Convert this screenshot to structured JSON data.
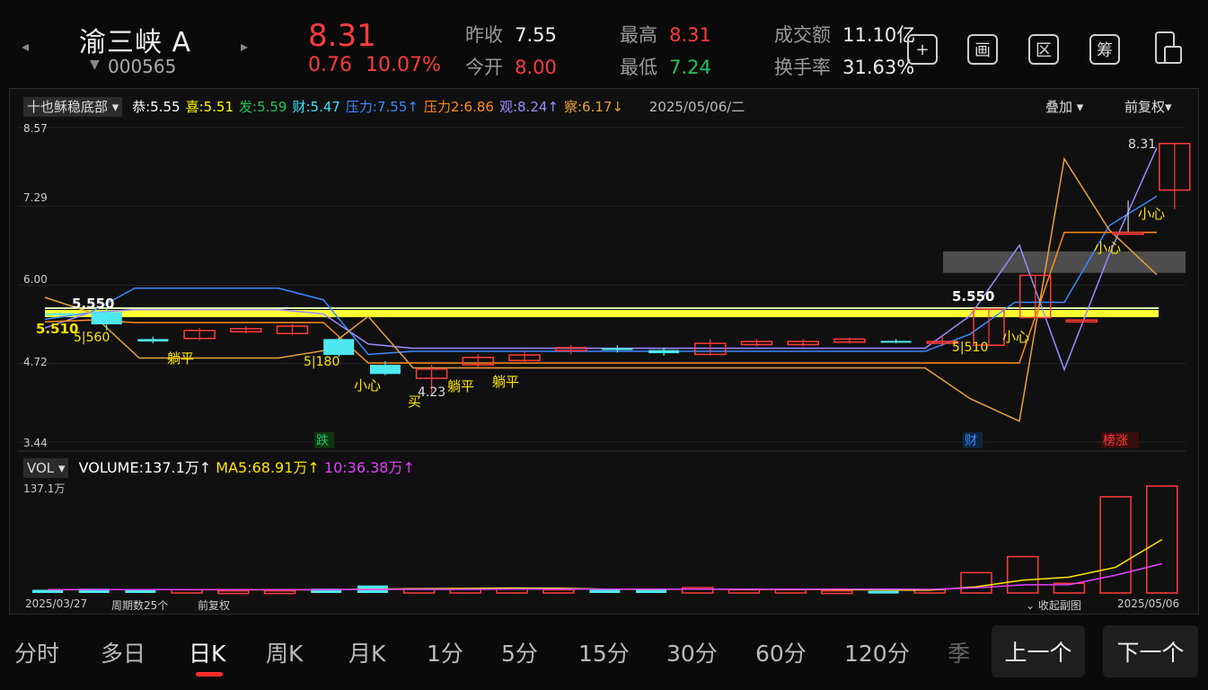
{
  "header": {
    "name": "渝三峡 A",
    "code": "000565",
    "price": "8.31",
    "change": "0.76",
    "change_pct": "10.07%",
    "prev_close_label": "昨收",
    "prev_close": "7.55",
    "open_label": "今开",
    "open": "8.00",
    "high_label": "最高",
    "high": "8.31",
    "low_label": "最低",
    "low": "7.24",
    "turnover_label": "成交额",
    "turnover": "11.10亿",
    "rate_label": "换手率",
    "rate": "31.63%"
  },
  "toolbar_icons": [
    "add-icon",
    "draw-icon",
    "range-icon",
    "chip-icon",
    "fullscreen-icon"
  ],
  "toolbar_text": {
    "draw": "画",
    "range": "区",
    "chip": "筹"
  },
  "indicator": {
    "name": "十也稣稳底部",
    "items": [
      {
        "label": "恭:",
        "value": "5.55",
        "color": "#ffffff"
      },
      {
        "label": "喜:",
        "value": "5.51",
        "color": "#ffff00"
      },
      {
        "label": "发:",
        "value": "5.59",
        "color": "#21c55d"
      },
      {
        "label": "财:",
        "value": "5.47",
        "color": "#40e0ff"
      },
      {
        "label": "压力:",
        "value": "7.55↑",
        "color": "#3b8bff"
      },
      {
        "label": "压力2:",
        "value": "6.86",
        "color": "#ff8c1a"
      },
      {
        "label": "观:",
        "value": "8.24↑",
        "color": "#9b8cff"
      },
      {
        "label": "察:",
        "value": "6.17↓",
        "color": "#e6a23c"
      }
    ],
    "date": "2025/05/06/二",
    "overlay": "叠加",
    "adjust": "前复权"
  },
  "price_axis": [
    "8.57",
    "7.29",
    "6.00",
    "4.72",
    "3.44"
  ],
  "chart_labels": {
    "hi_left": "5.550",
    "lo_left": "5.510",
    "hi_right": "5.550",
    "max_price": "8.31",
    "min_price": "4.23",
    "fall": "跌",
    "cai": "财",
    "bang": "榜",
    "zhang": "涨",
    "lie1": "躺平",
    "lie2": "躺平",
    "lie3": "躺平",
    "careful1": "小心",
    "careful2": "小心",
    "careful3": "小心",
    "careful4": "小心",
    "buy": "买",
    "s1": "5|560",
    "s2": "5|180",
    "s3": "5|510"
  },
  "volume": {
    "name": "VOL",
    "vol_label": "VOLUME:",
    "vol": "137.1万↑",
    "ma5_label": "MA5:",
    "ma5": "68.91万↑",
    "ma10_label": "10:",
    "ma10": "36.38万↑",
    "axis_top": "137.1万"
  },
  "footer": {
    "start_date": "2025/03/27",
    "period": "周期数25个",
    "adjust": "前复权",
    "collapse": "收起副图",
    "end_date": "2025/05/06"
  },
  "tabs": [
    "分时",
    "多日",
    "日K",
    "周K",
    "月K",
    "1分",
    "5分",
    "15分",
    "30分",
    "60分",
    "120分",
    "季"
  ],
  "active_tab": "日K",
  "prev_button": "上一个",
  "next_button": "下一个",
  "chart_data": {
    "type": "candlestick",
    "categories": [
      "c1",
      "c2",
      "c3",
      "c4",
      "c5",
      "c6",
      "c7",
      "c8",
      "c9",
      "c10",
      "c11",
      "c12",
      "c13",
      "c14",
      "c15",
      "c16",
      "c17",
      "c18",
      "c19",
      "c20",
      "c21",
      "c22",
      "c23",
      "c24",
      "c25"
    ],
    "ylim": [
      3.44,
      8.57
    ],
    "candles": [
      {
        "o": 5.54,
        "c": 5.52,
        "h": 5.56,
        "l": 5.5
      },
      {
        "o": 5.56,
        "c": 5.36,
        "h": 5.63,
        "l": 5.26
      },
      {
        "o": 5.12,
        "c": 5.08,
        "h": 5.16,
        "l": 5.05
      },
      {
        "o": 5.13,
        "c": 5.26,
        "h": 5.3,
        "l": 5.1
      },
      {
        "o": 5.24,
        "c": 5.29,
        "h": 5.33,
        "l": 5.21
      },
      {
        "o": 5.21,
        "c": 5.33,
        "h": 5.36,
        "l": 5.18
      },
      {
        "o": 5.12,
        "c": 4.86,
        "h": 5.14,
        "l": 4.83
      },
      {
        "o": 4.7,
        "c": 4.55,
        "h": 4.76,
        "l": 4.53
      },
      {
        "o": 4.48,
        "c": 4.63,
        "h": 4.7,
        "l": 4.23
      },
      {
        "o": 4.7,
        "c": 4.82,
        "h": 4.87,
        "l": 4.66
      },
      {
        "o": 4.77,
        "c": 4.86,
        "h": 4.93,
        "l": 4.73
      },
      {
        "o": 4.93,
        "c": 4.98,
        "h": 5.02,
        "l": 4.87
      },
      {
        "o": 4.97,
        "c": 4.94,
        "h": 5.02,
        "l": 4.9
      },
      {
        "o": 4.94,
        "c": 4.89,
        "h": 4.98,
        "l": 4.85
      },
      {
        "o": 4.87,
        "c": 5.05,
        "h": 5.12,
        "l": 4.85
      },
      {
        "o": 5.03,
        "c": 5.08,
        "h": 5.12,
        "l": 5.0
      },
      {
        "o": 5.03,
        "c": 5.08,
        "h": 5.12,
        "l": 5.0
      },
      {
        "o": 5.07,
        "c": 5.12,
        "h": 5.14,
        "l": 5.05
      },
      {
        "o": 5.09,
        "c": 5.08,
        "h": 5.12,
        "l": 5.05
      },
      {
        "o": 5.08,
        "c": 5.08,
        "h": 5.16,
        "l": 5.0
      },
      {
        "o": 5.02,
        "c": 5.61,
        "h": 5.61,
        "l": 5.0
      },
      {
        "o": 5.47,
        "c": 6.16,
        "h": 6.16,
        "l": 5.47
      },
      {
        "o": 5.43,
        "c": 5.43,
        "h": 5.43,
        "l": 5.43
      },
      {
        "o": 6.86,
        "c": 6.86,
        "h": 7.38,
        "l": 6.86
      },
      {
        "o": 7.55,
        "c": 8.31,
        "h": 8.31,
        "l": 7.24
      }
    ],
    "volumes": [
      1.5,
      2.0,
      1.5,
      1.5,
      1.0,
      1.0,
      2.0,
      3.5,
      2.0,
      2.0,
      2.0,
      1.5,
      1.5,
      1.5,
      2.5,
      1.5,
      1.5,
      1.0,
      1.0,
      1.5,
      9.5,
      17.0,
      4.5,
      45.0,
      50.0
    ],
    "ma5": [
      1.5,
      1.6,
      1.6,
      1.6,
      1.5,
      1.5,
      1.5,
      1.8,
      2.0,
      2.1,
      2.3,
      2.2,
      1.8,
      1.7,
      1.8,
      1.7,
      1.7,
      1.6,
      1.4,
      1.3,
      2.9,
      6.0,
      7.4,
      12.0,
      25.0
    ],
    "ma10": [
      1.5,
      1.6,
      1.6,
      1.6,
      1.5,
      1.5,
      1.5,
      1.7,
      1.7,
      1.7,
      1.8,
      1.8,
      1.8,
      1.8,
      1.8,
      1.8,
      1.8,
      1.8,
      1.8,
      1.7,
      2.4,
      3.8,
      3.9,
      8.3,
      13.7
    ]
  }
}
